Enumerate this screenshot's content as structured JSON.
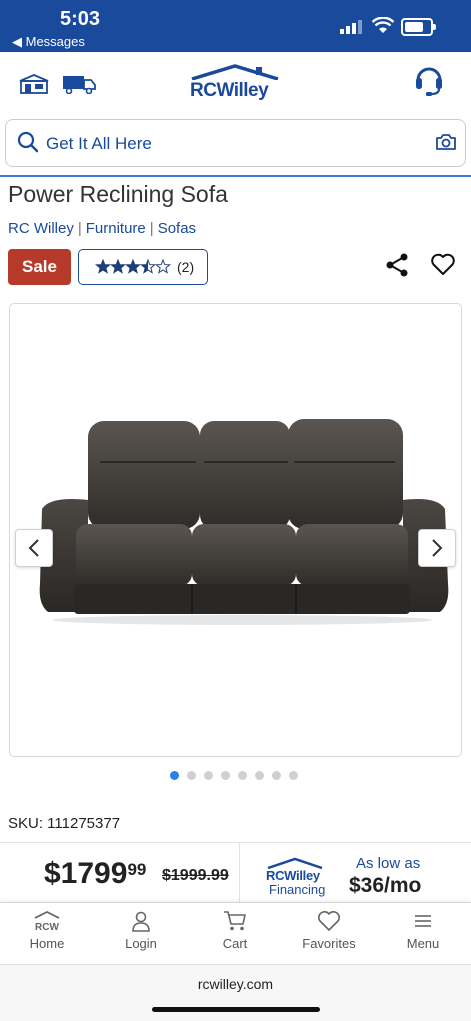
{
  "status_bar": {
    "time": "5:03",
    "back_label": "◀ Messages"
  },
  "header": {
    "logo_text": "RCWilley",
    "icons": [
      "store-locator-icon",
      "delivery-truck-icon",
      "customer-service-headset-icon"
    ]
  },
  "search": {
    "placeholder": "Get It All Here"
  },
  "product": {
    "title": "Power Reclining Sofa",
    "breadcrumb": [
      "RC Willey",
      "Furniture",
      "Sofas"
    ],
    "sale_label": "Sale",
    "rating": 3.5,
    "rating_max": 5,
    "review_count": "(2)",
    "sku_label": "SKU: 111275377",
    "price_dollars": "$1799",
    "price_cents": "99",
    "old_price": "$1999.99",
    "image_count": 8,
    "image_index": 1
  },
  "financing": {
    "logo_text": "RCWilley",
    "label": "Financing",
    "as_low_as": "As low as",
    "monthly": "$36/mo"
  },
  "tabbar": {
    "items": [
      {
        "label": "Home",
        "icon": "rcw-home-icon"
      },
      {
        "label": "Login",
        "icon": "user-icon"
      },
      {
        "label": "Cart",
        "icon": "cart-icon"
      },
      {
        "label": "Favorites",
        "icon": "heart-icon"
      },
      {
        "label": "Menu",
        "icon": "hamburger-menu-icon"
      }
    ]
  },
  "browser": {
    "url": "rcwilley.com"
  },
  "colors": {
    "brand_blue": "#1a4a9c",
    "sale_red": "#b63a2a",
    "dot_active": "#2b7de9"
  }
}
